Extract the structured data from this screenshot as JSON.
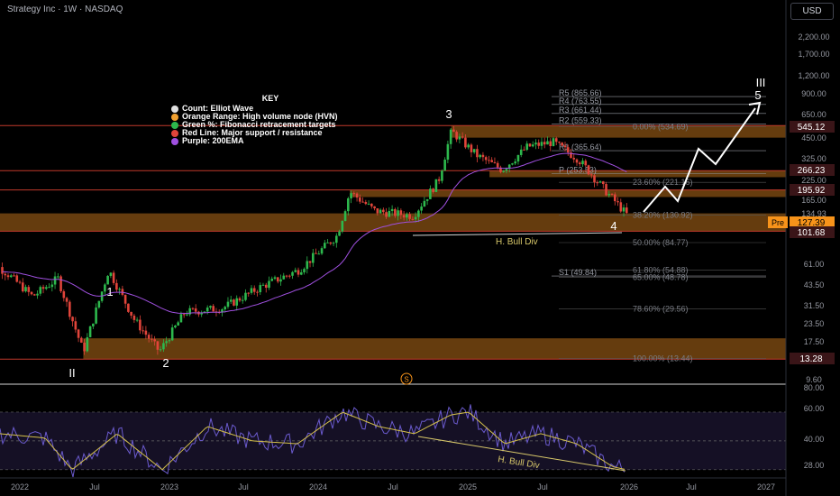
{
  "header": {
    "symbol": "Strategy Inc · 1W · NASDAQ",
    "currency": "USD"
  },
  "key": {
    "title": "KEY",
    "items": [
      {
        "label": "Count: Elliot Wave",
        "color": "#e0e0e0",
        "icon": "white-dot-icon"
      },
      {
        "label": "Orange Range: High volume node (HVN)",
        "color": "#f0a030",
        "icon": "orange-dot-icon"
      },
      {
        "label": "Green %: Fibonacci retracement targets",
        "color": "#2db84d",
        "icon": "green-dot-icon"
      },
      {
        "label": "Red Line: Major support / resistance",
        "color": "#e0443a",
        "icon": "red-dot-icon"
      },
      {
        "label": "Purple: 200EMA",
        "color": "#a050e0",
        "icon": "purple-dot-icon"
      }
    ]
  },
  "chart_data": {
    "type": "candlestick",
    "x_axis": [
      "2022",
      "Jul",
      "2023",
      "Jul",
      "2024",
      "Jul",
      "2025",
      "Jul",
      "2026",
      "Jul",
      "2027"
    ],
    "price_scale_labels": [
      "2,200.00",
      "1,700.00",
      "1,200.00",
      "900.00",
      "650.00",
      "450.00",
      "325.00",
      "225.00",
      "165.00",
      "134.93",
      "61.00",
      "43.50",
      "31.50",
      "23.50",
      "17.50",
      "9.60"
    ],
    "price_tags": [
      {
        "value": "545.12",
        "kind": "resistance",
        "bg": "#3a1518"
      },
      {
        "value": "266.23",
        "kind": "resistance",
        "bg": "#3a1518"
      },
      {
        "value": "195.92",
        "kind": "resistance",
        "bg": "#3a1518"
      },
      {
        "value": "127.39",
        "kind": "current",
        "prefix": "Pre",
        "bg": "#f7931a"
      },
      {
        "value": "101.68",
        "kind": "support",
        "bg": "#3a1518"
      },
      {
        "value": "13.28",
        "kind": "support",
        "bg": "#3a1518"
      }
    ],
    "red_levels": [
      545.12,
      266.23,
      195.92,
      101.68,
      13.28
    ],
    "hvn_zones": [
      {
        "from": 450,
        "to": 545.12,
        "start": "2024-11"
      },
      {
        "from": 240,
        "to": 266.23,
        "start": "2025-02"
      },
      {
        "from": 175,
        "to": 195.92,
        "start": "2024-03"
      },
      {
        "from": 101.68,
        "to": 134.93,
        "start": "2021-10"
      },
      {
        "from": 13.28,
        "to": 18.5,
        "start": "2022-06"
      }
    ],
    "fib_levels": [
      {
        "label": "0.00% (534.69)",
        "value": 534.69
      },
      {
        "label": "23.60% (221.16)",
        "value": 221.16
      },
      {
        "label": "38.20% (130.92)",
        "value": 130.92
      },
      {
        "label": "50.00% (84.77)",
        "value": 84.77
      },
      {
        "label": "61.80% (54.88)",
        "value": 54.88
      },
      {
        "label": "65.00% (48.78)",
        "value": 48.78
      },
      {
        "label": "78.60% (29.56)",
        "value": 29.56
      },
      {
        "label": "100.00% (13.44)",
        "value": 13.44
      }
    ],
    "pivots": [
      {
        "label": "R5 (865.66)",
        "value": 865.66
      },
      {
        "label": "R4 (763.55)",
        "value": 763.55
      },
      {
        "label": "R3 (661.44)",
        "value": 661.44
      },
      {
        "label": "R2 (559.33)",
        "value": 559.33
      },
      {
        "label": "R1 (365.64)",
        "value": 365.64
      },
      {
        "label": "P (253.53)",
        "value": 253.53
      },
      {
        "label": "S1 (49.84)",
        "value": 49.84
      }
    ],
    "wave_labels": [
      {
        "label": "II",
        "date": "2022-06",
        "value": 13.28
      },
      {
        "label": "1",
        "date": "2022-08",
        "value": 55
      },
      {
        "label": "2",
        "date": "2022-12",
        "value": 13.28
      },
      {
        "label": "3",
        "date": "2024-11",
        "value": 545.12
      },
      {
        "label": "4",
        "date": "2026-01",
        "value": 101.68
      },
      {
        "label": "5",
        "date": "2026-12",
        "value": 865.66
      },
      {
        "label": "III",
        "date": "2026-12",
        "value": 1200
      }
    ],
    "projection_path": [
      {
        "date": "2026-02",
        "value": 140
      },
      {
        "date": "2026-04",
        "value": 210
      },
      {
        "date": "2026-05",
        "value": 165
      },
      {
        "date": "2026-08",
        "value": 390
      },
      {
        "date": "2026-09",
        "value": 300
      },
      {
        "date": "2026-12",
        "value": 780
      }
    ],
    "annotations": [
      {
        "text": "H. Bull Div",
        "panel": "price"
      },
      {
        "text": "H. Bull Div",
        "panel": "rsi"
      },
      {
        "text": "S",
        "panel": "divider"
      }
    ],
    "rsi_scale": [
      "80.00",
      "60.00",
      "40.00",
      "28.00"
    ],
    "rsi_levels": [
      70,
      50,
      30
    ],
    "colors": {
      "up": "#2db84d",
      "down": "#e0443a",
      "ema": "#a050e0",
      "hvn": "#b86e1a",
      "red_line": "#c0392b",
      "rsi": "#6a5acd",
      "rsi_ma": "#d4c04a"
    }
  }
}
